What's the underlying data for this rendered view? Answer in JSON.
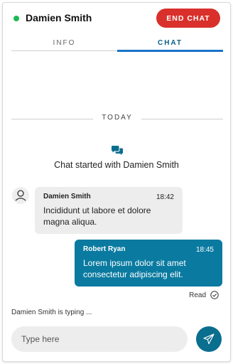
{
  "header": {
    "contact_name": "Damien Smith",
    "status": "online",
    "end_chat_label": "END CHAT"
  },
  "tabs": [
    {
      "label": "INFO",
      "active": false
    },
    {
      "label": "CHAT",
      "active": true
    }
  ],
  "day_divider": "TODAY",
  "chat_started": "Chat started with Damien Smith",
  "messages": [
    {
      "sender": "Damien Smith",
      "time": "18:42",
      "text": "Incididunt ut labore et dolore magna aliqua.",
      "direction": "incoming"
    },
    {
      "sender": "Robert Ryan",
      "time": "18:45",
      "text": "Lorem ipsum dolor sit amet consectetur adipiscing elit.",
      "direction": "outgoing"
    }
  ],
  "read_status": "Read",
  "typing_indicator": "Damien Smith is typing ...",
  "composer": {
    "placeholder": "Type here"
  },
  "icons": {
    "chat": "chat-bubbles-icon",
    "avatar": "user-avatar-icon",
    "read": "check-circle-icon",
    "send": "paper-plane-icon"
  },
  "colors": {
    "status_online": "#1db954",
    "end_chat": "#d9302c",
    "tab_active": "#1a73c9",
    "outgoing_bubble": "#0a7aa0",
    "incoming_bubble": "#ededed",
    "send_button": "#0a6e8f"
  }
}
